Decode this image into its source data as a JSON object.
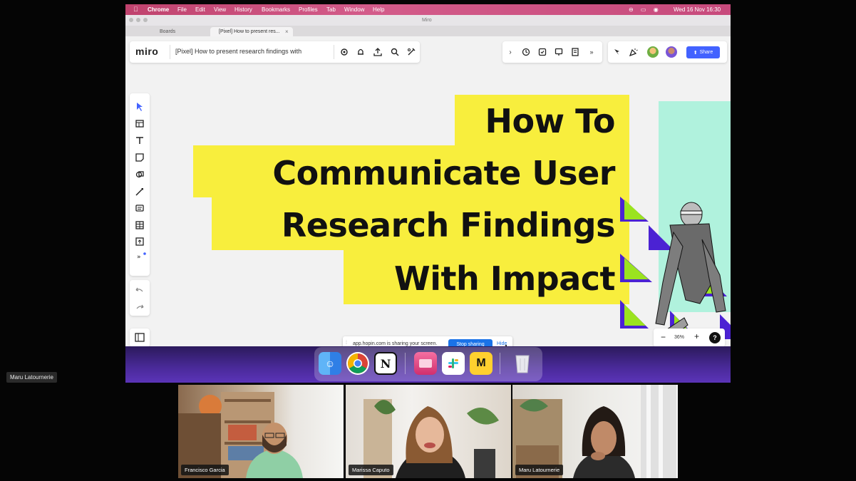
{
  "meeting": {
    "speaker_label": "Maru Latournerie",
    "participants": [
      {
        "name": "Francisco Garcia"
      },
      {
        "name": "Marissa Caputo"
      },
      {
        "name": "Maru Latournerie"
      }
    ]
  },
  "mac_menubar": {
    "app": "Chrome",
    "menus": [
      "File",
      "Edit",
      "View",
      "History",
      "Bookmarks",
      "Profiles",
      "Tab",
      "Window",
      "Help"
    ],
    "clock": "Wed 16 Nov  16:30"
  },
  "browser": {
    "window_title": "Miro",
    "tabs": [
      {
        "label": "Boards",
        "active": false
      },
      {
        "label": "[Pixel] How to present res...",
        "active": true
      }
    ]
  },
  "miro": {
    "logo": "miro",
    "board_title": "[Pixel] How to present research findings with",
    "share_label": "Share",
    "zoom": "36%",
    "help": "?",
    "left_tools": [
      "select-icon",
      "template-icon",
      "text-icon",
      "sticky-note-icon",
      "shapes-icon",
      "pen-icon",
      "comment-icon",
      "table-icon",
      "upload-icon",
      "more-tools-icon"
    ],
    "top_actions": [
      "settings-icon",
      "bell-icon",
      "export-icon",
      "search-icon",
      "magic-icon"
    ],
    "collab_actions": [
      "timer-icon",
      "vote-icon",
      "present-icon",
      "notes-icon",
      "chevron-down-icon"
    ],
    "slide_title_lines": [
      "How To",
      "Communicate User",
      "Research Findings",
      "With Impact"
    ],
    "colors": {
      "highlight": "#f8ee3d",
      "mint": "#b0f2dd",
      "accent": "#4262ff",
      "triangle_green": "#9be31f",
      "triangle_purple": "#4b22d3"
    }
  },
  "screen_share_bar": {
    "message": "app.hopin.com is sharing your screen.",
    "stop_label": "Stop sharing",
    "hide_label": "Hide"
  },
  "dock": {
    "apps": [
      "Finder",
      "Chrome",
      "Notion",
      "CleanMyMac",
      "Slack",
      "Miro",
      "Trash"
    ]
  }
}
